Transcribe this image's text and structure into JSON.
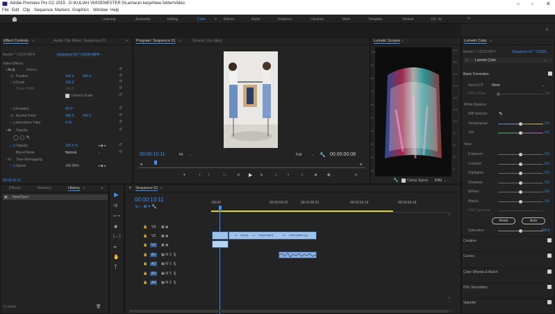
{
  "window": {
    "title": "Adobe Premiere Pro CC 2019 - D:\\KULIAH VM\\SEMESTER 5\\Lamaran kerja\\New folder\\Video",
    "minimize": "–",
    "maximize": "▫",
    "close": "✕"
  },
  "menu": [
    "File",
    "Edit",
    "Clip",
    "Sequence",
    "Markers",
    "Graphics",
    "Window",
    "Help"
  ],
  "workspaces": [
    "Learning",
    "Assembly",
    "Editing",
    "Color",
    "Effects",
    "Audio",
    "Graphics",
    "Libraries",
    "Work",
    "Template",
    "Vertical",
    "D2- fal"
  ],
  "workspace_more": "»",
  "effect_controls": {
    "tab1": "Effect Controls",
    "tab2": "Audio Clip Mixer: Sequence 01",
    "more": "»",
    "source": "Master * C0100.MP4",
    "sequence": "Sequence 01 * C0100.MP4",
    "video_effects": "Video Effects",
    "motion": "Motion",
    "position_label": "Position",
    "position_x": "540.0",
    "position_y": "960.0",
    "scale_label": "Scale",
    "scale_value": "100.0",
    "scale_width_label": "Scale Width",
    "scale_width_value": "100.0",
    "uniform_scale": "Uniform Scale",
    "rotation_label": "Rotation",
    "rotation_value": "90.0 °",
    "anchor_label": "Anchor Point",
    "anchor_x": "960.0",
    "anchor_y": "540.0",
    "flicker_label": "Anti-flicker Filter",
    "flicker_value": "0.00",
    "opacity_section": "Opacity",
    "opacity_label": "Opacity",
    "opacity_value": "100.0 %",
    "blend_label": "Blend Mode",
    "blend_value": "Normal",
    "time_remap": "Time Remapping",
    "speed_label": "Speed",
    "speed_value": "100.00%",
    "timecode": "00:00:10:11"
  },
  "program": {
    "tab": "Program: Sequence 01",
    "source_tab": "Source: (no clips)",
    "timecode": "00:00:10:11",
    "fit": "Fit",
    "full": "Full",
    "duration": "00:00:00:08"
  },
  "scopes": {
    "tab": "Lumetri Scopes",
    "clamp": "Clamp Signal",
    "bit": "8 Bit",
    "left_scale": [
      "100",
      "90",
      "80",
      "70",
      "60",
      "50",
      "40",
      "30",
      "20",
      "10"
    ],
    "right_scale": [
      "255",
      "230",
      "204",
      "178",
      "153",
      "128",
      "102",
      "76",
      "51",
      "26",
      "0"
    ]
  },
  "lumetri": {
    "tab": "Lumetri Color",
    "more": "»",
    "source": "Master * C0100.MP4",
    "sequence": "Sequence 01 * C0100...",
    "fx_label": "fx",
    "fx_name": "Lumetri Color",
    "basic_correction": "Basic Correction",
    "input_lut_label": "Input LUT",
    "input_lut_value": "None",
    "hdr_white": "HDR White",
    "hdr_white_value": "100",
    "white_balance": "White Balance",
    "wb_selector": "WB Selector",
    "temperature": "Temperature",
    "tint": "Tint",
    "tone": "Tone",
    "tone_items": [
      "Exposure",
      "Contrast",
      "Highlights",
      "Shadows",
      "Whites",
      "Blacks"
    ],
    "hdr_specular": "HDR Specular",
    "zero": "0.0",
    "reset_btn": "Reset",
    "auto_btn": "Auto",
    "saturation": "Saturation",
    "saturation_value": "100.0",
    "sections": [
      "Creative",
      "Curves",
      "Color Wheels & Match",
      "HSL Secondary",
      "Vignette"
    ]
  },
  "history": {
    "tabs": [
      "Effects",
      "Markers",
      "History"
    ],
    "more": "»",
    "item": "New/Open",
    "undos": "0 Undos"
  },
  "timeline": {
    "tab": "Sequence 01",
    "timecode": "00:00:10:11",
    "ruler": [
      ":00:00",
      "00:00:59:22",
      "00:01:59:21",
      "00:02:59:19",
      "00:03:59:18"
    ],
    "video_tracks": [
      "V3",
      "V2",
      "V1"
    ],
    "audio_tracks": [
      "A1",
      "A2",
      "A3",
      "A4"
    ],
    "clip1": "C0101",
    "clip2": "C0100.MP4",
    "clip3": "C0379.MP4 [V]"
  },
  "colors": {
    "accent": "#3d8ff5",
    "panel": "#232323",
    "clip": "#9ec3ea",
    "yellow": "#d9d23a"
  }
}
